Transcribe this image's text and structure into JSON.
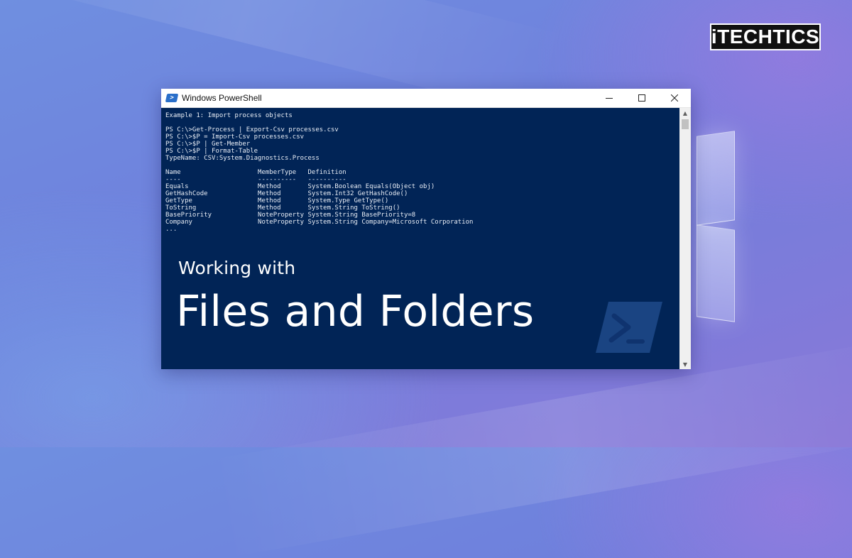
{
  "brand": {
    "logo_text": "iTECHTICS"
  },
  "window": {
    "title": "Windows PowerShell",
    "icon": "powershell-icon",
    "controls": {
      "minimize": "minimize-icon",
      "maximize": "maximize-icon",
      "close": "close-icon"
    }
  },
  "console": {
    "lines": [
      "Example 1: Import process objects",
      "",
      "PS C:\\>Get-Process | Export-Csv processes.csv",
      "PS C:\\>$P = Import-Csv processes.csv",
      "PS C:\\>$P | Get-Member",
      "PS C:\\>$P | Format-Table",
      "TypeName: CSV:System.Diagnostics.Process",
      "",
      "Name                    MemberType   Definition",
      "----                    ----------   ----------",
      "Equals                  Method       System.Boolean Equals(Object obj)",
      "GetHashCode             Method       System.Int32 GetHashCode()",
      "GetType                 Method       System.Type GetType()",
      "ToString                Method       System.String ToString()",
      "BasePriority            NoteProperty System.String BasePriority=8",
      "Company                 NoteProperty System.String Company=Microsoft Corporation",
      "..."
    ]
  },
  "overlay": {
    "subtitle": "Working with",
    "title": "Files and Folders"
  },
  "colors": {
    "console_bg": "#012456",
    "console_text": "#e8edf5",
    "brand_accent": "#d01f26"
  }
}
